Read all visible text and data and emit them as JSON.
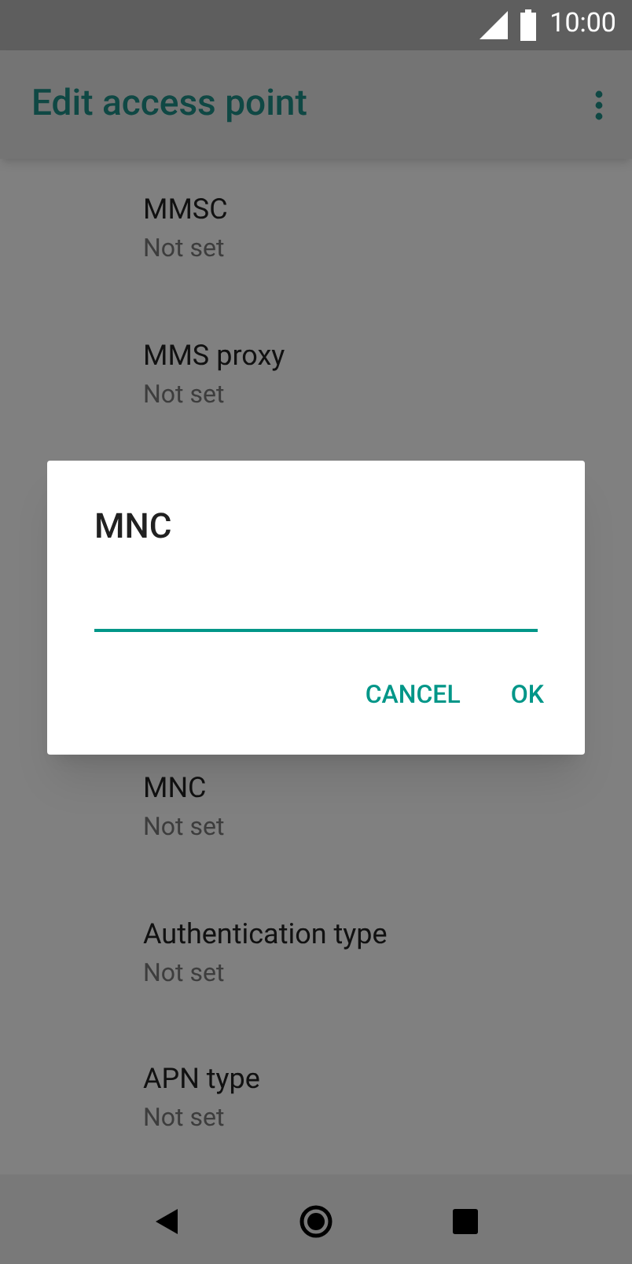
{
  "status_bar": {
    "time": "10:00"
  },
  "app_bar": {
    "title": "Edit access point"
  },
  "settings_above": [
    {
      "title": "MMSC",
      "value": "Not set"
    },
    {
      "title": "MMS proxy",
      "value": "Not set"
    }
  ],
  "settings_below": [
    {
      "title": "MNC",
      "value": "Not set"
    },
    {
      "title": "Authentication type",
      "value": "Not set"
    },
    {
      "title": "APN type",
      "value": "Not set"
    }
  ],
  "dialog": {
    "title": "MNC",
    "buttons": [
      "CANCEL",
      "OK"
    ]
  }
}
